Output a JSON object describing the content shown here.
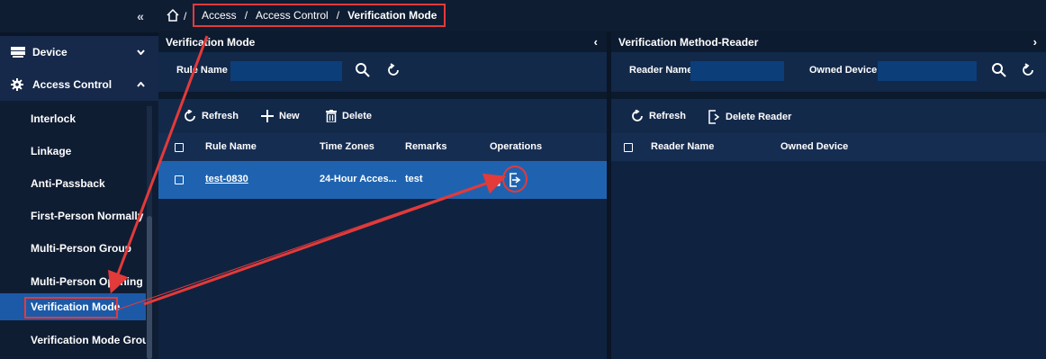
{
  "sidebar": {
    "collapse_glyph": "«",
    "groups": [
      {
        "label": "Device",
        "icon": "device-icon",
        "chevron": "⌄"
      },
      {
        "label": "Access Control",
        "icon": "gear-icon",
        "chevron": "˄"
      }
    ],
    "items": [
      {
        "label": "Interlock"
      },
      {
        "label": "Linkage"
      },
      {
        "label": "Anti-Passback"
      },
      {
        "label": "First-Person Normally Op"
      },
      {
        "label": "Multi-Person Group"
      },
      {
        "label": "Multi-Person Opening Dc"
      },
      {
        "label": "Verification Mode",
        "active": true
      },
      {
        "label": "Verification Mode Group"
      }
    ]
  },
  "breadcrumb": {
    "root_sep": "/",
    "items": [
      "Access",
      "Access Control",
      "Verification Mode"
    ],
    "sep": "/"
  },
  "left_panel": {
    "title": "Verification Mode",
    "collapse_glyph": "‹",
    "filter": {
      "rule_name_label": "Rule Name",
      "rule_name_value": ""
    },
    "toolbar": {
      "refresh": "Refresh",
      "new": "New",
      "delete": "Delete"
    },
    "columns": [
      "Rule Name",
      "Time Zones",
      "Remarks",
      "Operations"
    ],
    "rows": [
      {
        "rule_name": "test-0830",
        "time_zones": "24-Hour Acces...",
        "remarks": "test"
      }
    ]
  },
  "right_panel": {
    "title": "Verification Method-Reader",
    "collapse_glyph": "›",
    "filter": {
      "reader_name_label": "Reader Name",
      "owned_device_label": "Owned Device",
      "reader_name_value": "",
      "owned_device_value": ""
    },
    "toolbar": {
      "refresh": "Refresh",
      "delete_reader": "Delete Reader"
    },
    "columns": [
      "Reader Name",
      "Owned Device"
    ]
  },
  "colors": {
    "accent": "#1f63b0",
    "annotation_red": "#e33a3a",
    "bg_dark": "#0f1d33",
    "input_blue": "#0c3e7a"
  }
}
